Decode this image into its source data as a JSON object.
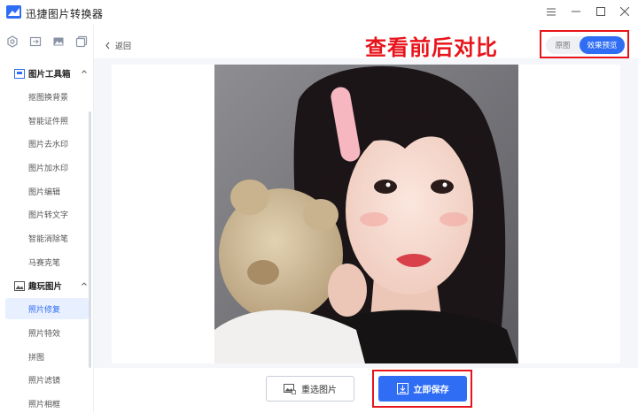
{
  "app": {
    "title": "迅捷图片转换器",
    "accent_color": "#2f6ef4",
    "highlight_color": "#e8141b"
  },
  "window_controls": {
    "menu_icon": "hamburger-menu-icon",
    "minimize_icon": "minimize-icon",
    "maximize_icon": "maximize-icon",
    "close_icon": "close-icon"
  },
  "sidebar": {
    "top_icons": [
      "settings-hex-icon",
      "convert-icon",
      "image-icon",
      "copy-icon"
    ],
    "groups": [
      {
        "label": "图片工具箱",
        "icon": "toolbox-icon",
        "expanded": true,
        "items": [
          {
            "label": "抠图换背景",
            "active": false
          },
          {
            "label": "智能证件照",
            "active": false
          },
          {
            "label": "图片去水印",
            "active": false
          },
          {
            "label": "图片加水印",
            "active": false
          },
          {
            "label": "图片编辑",
            "active": false
          },
          {
            "label": "图片转文字",
            "active": false
          },
          {
            "label": "智能消除笔",
            "active": false
          },
          {
            "label": "马赛克笔",
            "active": false
          }
        ]
      },
      {
        "label": "趣玩图片",
        "icon": "fun-image-icon",
        "expanded": true,
        "items": [
          {
            "label": "照片修复",
            "active": true
          },
          {
            "label": "照片特效",
            "active": false
          },
          {
            "label": "拼图",
            "active": false
          },
          {
            "label": "照片滤镜",
            "active": false
          },
          {
            "label": "照片相框",
            "active": false
          }
        ]
      }
    ]
  },
  "main": {
    "back_label": "返回",
    "compare_note": "查看前后对比",
    "toggle": {
      "original_label": "原图",
      "preview_label": "效果预览",
      "selected": "效果预览"
    },
    "reselect_label": "重选图片",
    "save_label": "立即保存"
  }
}
